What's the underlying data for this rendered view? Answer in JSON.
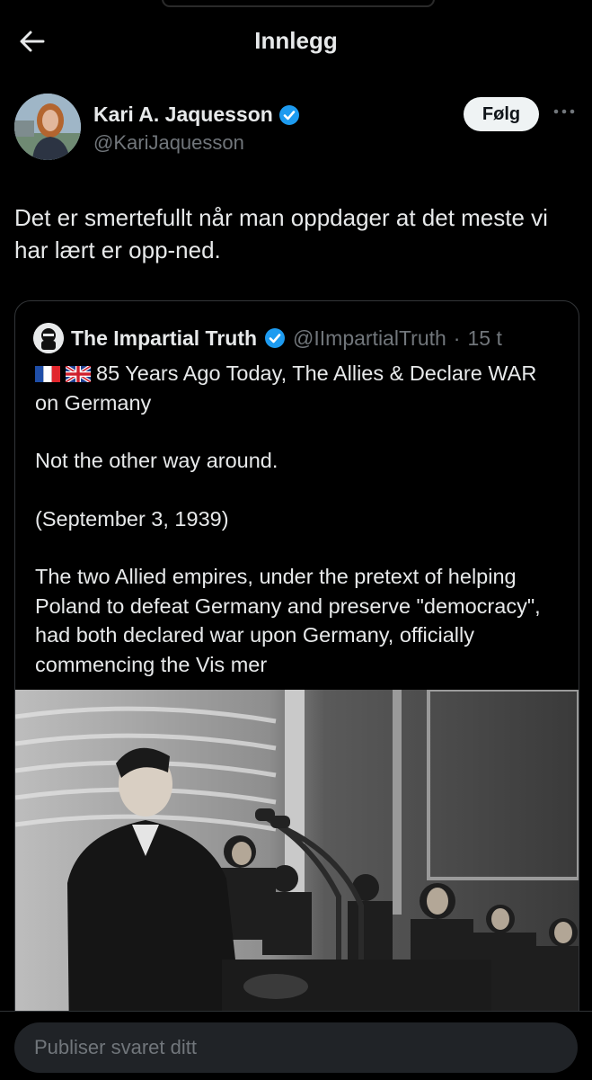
{
  "header": {
    "title": "Innlegg",
    "back_icon": "arrow-left-icon"
  },
  "author": {
    "name": "Kari A. Jaquesson",
    "handle": "@KariJaquesson",
    "verified": true,
    "follow_label": "Følg",
    "more_icon": "ellipsis-icon"
  },
  "post": {
    "text": "Det er smertefullt når man oppdager at det meste vi har lært er opp-ned."
  },
  "quote": {
    "name": "The Impartial Truth",
    "handle": "@IImpartialTruth",
    "separator": "·",
    "time": "15 t",
    "verified": true,
    "flags": [
      "france-flag",
      "uk-flag"
    ],
    "paragraph1": "85 Years Ago Today, The Allies & Declare WAR on Germany",
    "paragraph2": "Not the other way around.",
    "paragraph3": "(September 3, 1939)",
    "paragraph4": "The two Allied empires, under the pretext of helping Poland to defeat Germany and preserve \"democracy\", had both declared war upon Germany, officially commencing the",
    "show_more": "Vis mer"
  },
  "reply": {
    "placeholder": "Publiser svaret ditt"
  },
  "colors": {
    "background": "#000000",
    "text": "#e7e9ea",
    "muted": "#71767b",
    "verified": "#1d9bf0"
  }
}
